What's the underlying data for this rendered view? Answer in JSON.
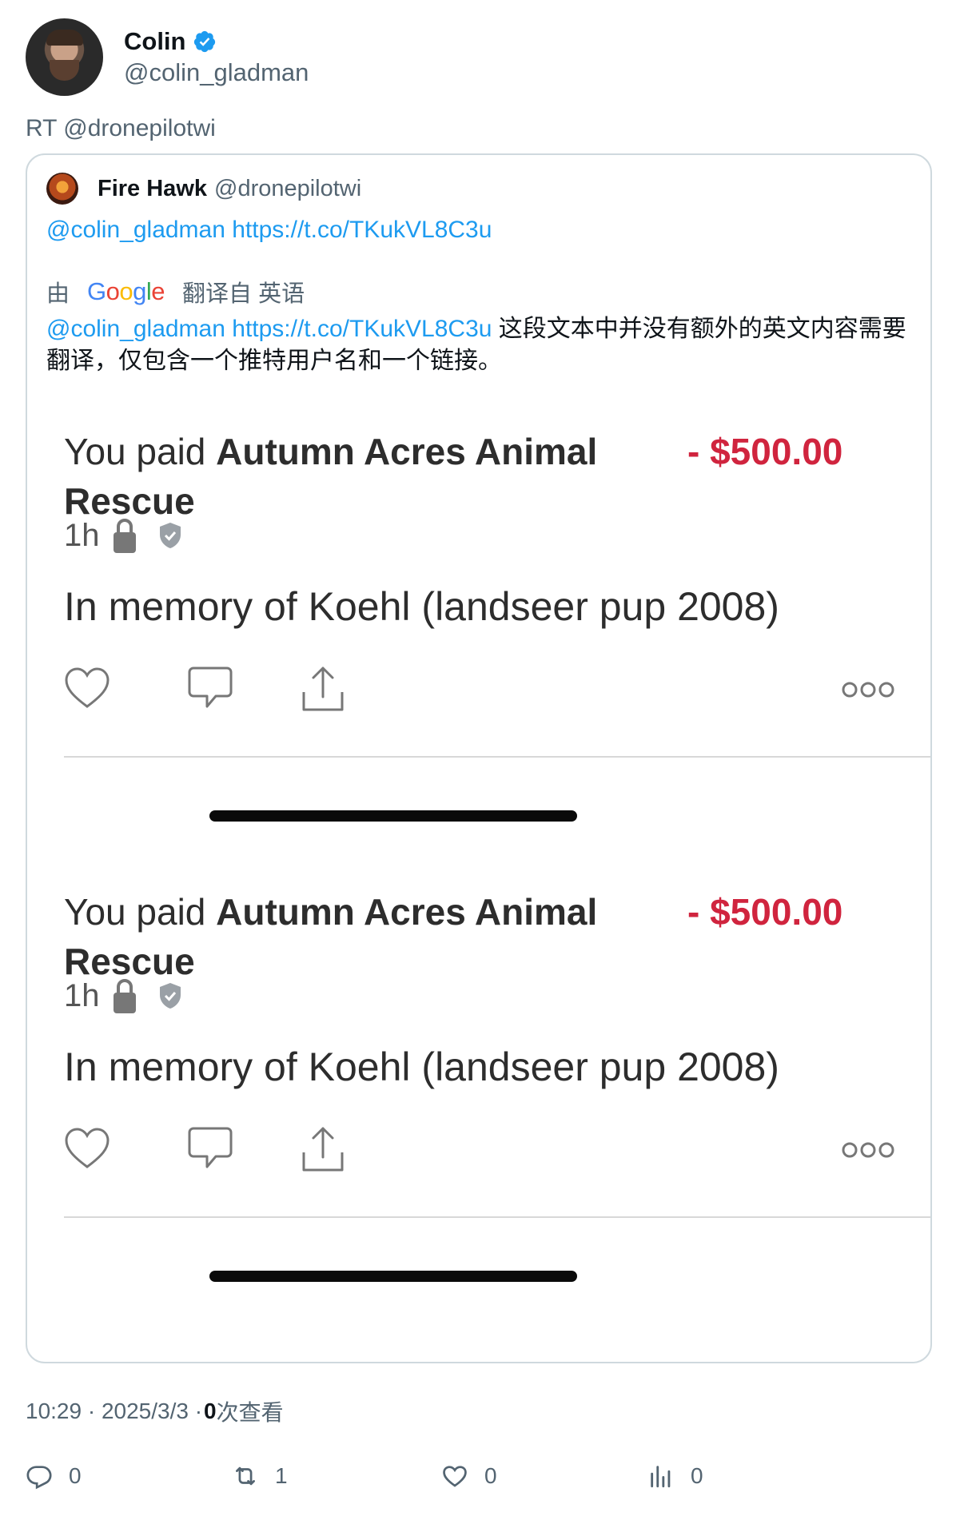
{
  "author": {
    "name": "Colin",
    "handle": "@colin_gladman",
    "verified": true
  },
  "rt_line": "RT @dronepilotwi",
  "quote": {
    "name": "Fire Hawk",
    "handle": "@dronepilotwi",
    "original_text": "@colin_gladman https://t.co/TKukVL8C3u",
    "translate_prefix": "由",
    "translate_brand": "Google",
    "translate_suffix": "翻译自 英语",
    "translated_mention": "@colin_gladman",
    "translated_link": "https://t.co/TKukVL8C3u",
    "translated_text": " 这段文本中并没有额外的英文内容需要翻译，仅包含一个推特用户名和一个链接。"
  },
  "payments": [
    {
      "paid_prefix": "You paid ",
      "payee": "Autumn Acres Animal Rescue",
      "amount": "- $500.00",
      "time": "1h",
      "memo": "In memory of Koehl (landseer pup 2008)"
    },
    {
      "paid_prefix": "You paid ",
      "payee": "Autumn Acres Animal Rescue",
      "amount": "- $500.00",
      "time": "1h",
      "memo": "In memory of Koehl (landseer pup 2008)"
    }
  ],
  "footer": {
    "time": "10:29 · 2025/3/3 · ",
    "views_count": "0",
    "views_label": "次查看",
    "replies": "0",
    "retweets": "1",
    "likes": "0",
    "view_stats": "0"
  },
  "colors": {
    "link": "#1d9bf0",
    "amount": "#d0243e",
    "verified": "#1d9bf0"
  }
}
